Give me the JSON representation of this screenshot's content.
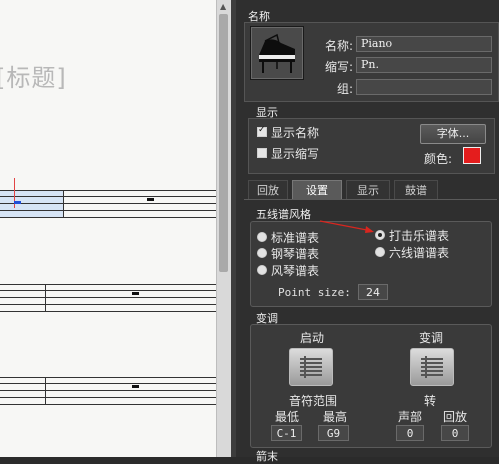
{
  "score": {
    "title": "[标题]"
  },
  "panel": {
    "name_section": "名称",
    "fields": {
      "name_label": "名称:",
      "name_value": "Piano",
      "abbr_label": "缩写:",
      "abbr_value": "Pn.",
      "group_label": "组:",
      "group_value": ""
    },
    "display": {
      "header": "显示",
      "show_name": "显示名称",
      "show_name_checked": true,
      "show_abbr": "显示缩写",
      "show_abbr_checked": false,
      "font_button": "字体...",
      "color_label": "颜色:",
      "color_value": "#e41d1d"
    },
    "tabs": [
      "回放",
      "设置",
      "显示",
      "鼓谱"
    ],
    "active_tab": "设置",
    "staff_style": {
      "header": "五线谱风格",
      "options": [
        "标准谱表",
        "打击乐谱表",
        "钢琴谱表",
        "六线谱谱表",
        "风琴谱表"
      ],
      "selected": "打击乐谱表",
      "point_size_label": "Point size:",
      "point_size_value": "24"
    },
    "transpose": {
      "header": "变调",
      "enable_label": "启动",
      "transpose_label": "变调",
      "range_label": "音符范围",
      "low_label": "最低",
      "low_value": "C-1",
      "high_label": "最高",
      "high_value": "G9",
      "turn_label": "转",
      "part_label": "声部",
      "part_value": "0",
      "playback_label": "回放",
      "playback_value": "0"
    },
    "bottom_section": "箭末"
  }
}
